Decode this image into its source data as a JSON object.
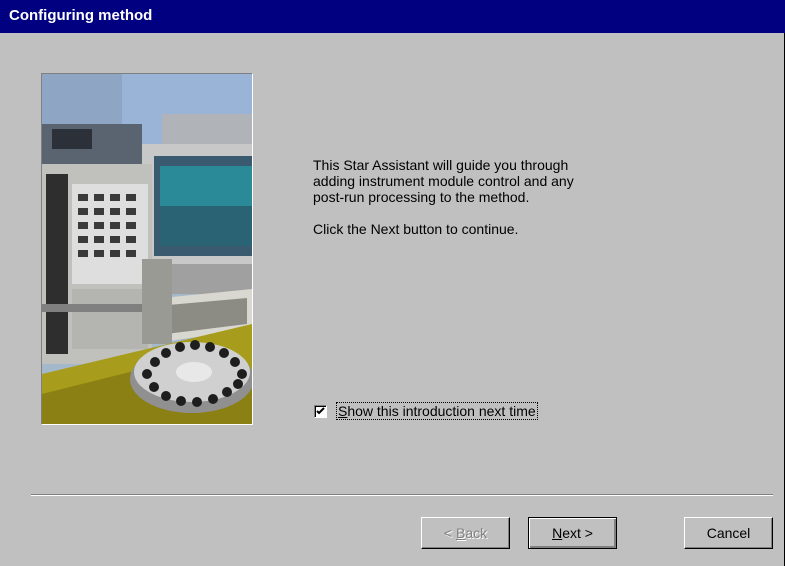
{
  "window": {
    "title": "Configuring method"
  },
  "intro": {
    "lines": [
      "This Star Assistant will guide you through",
      "adding instrument module control and any",
      "post-run processing to the method."
    ],
    "continue_text": "Click the Next button to continue."
  },
  "checkbox": {
    "label_underlined": "S",
    "label_rest": "how this introduction next time",
    "checked": true
  },
  "buttons": {
    "back": {
      "prefix": "< ",
      "underlined": "B",
      "rest": "ack",
      "enabled": false
    },
    "next": {
      "prefix": "",
      "underlined": "N",
      "rest": "ext >",
      "enabled": true
    },
    "cancel": {
      "label": "Cancel",
      "enabled": true
    }
  },
  "icons": {
    "photo": "lab-instrument-photo",
    "checkmark": "checkmark-icon"
  }
}
